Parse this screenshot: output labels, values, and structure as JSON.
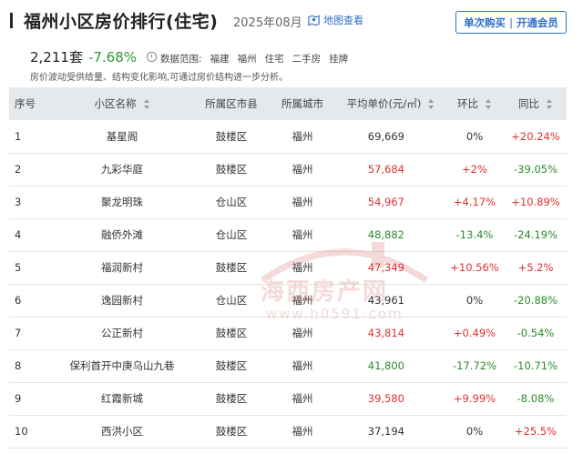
{
  "header": {
    "title": "福州小区房价排行(住宅)",
    "date": "2025年08月",
    "map_link": "地图查看",
    "buy_once": "单次购买",
    "divider": "|",
    "open_member": "开通会员"
  },
  "stats": {
    "count": "2,211套",
    "change": "-7.68%",
    "scope_label": "数据范围:",
    "tags": [
      "福建",
      "福州",
      "住宅",
      "二手房",
      "挂牌"
    ],
    "note": "房价波动受供给量、结构变化影响,可通过房价结构进一步分析。"
  },
  "table": {
    "columns": [
      "序号",
      "小区名称",
      "所属区市县",
      "所属城市",
      "平均单价(元/㎡)",
      "环比",
      "同比"
    ],
    "rows": [
      {
        "rank": "1",
        "name": "基星阁",
        "district": "鼓楼区",
        "city": "福州",
        "price": "69,669",
        "mom": "0%",
        "mom_dir": "zero",
        "yoy": "+20.24%",
        "yoy_dir": "pos",
        "price_dir": "zero"
      },
      {
        "rank": "2",
        "name": "九彩华庭",
        "district": "鼓楼区",
        "city": "福州",
        "price": "57,684",
        "mom": "+2%",
        "mom_dir": "pos",
        "yoy": "-39.05%",
        "yoy_dir": "neg",
        "price_dir": "pos"
      },
      {
        "rank": "3",
        "name": "聚龙明珠",
        "district": "仓山区",
        "city": "福州",
        "price": "54,967",
        "mom": "+4.17%",
        "mom_dir": "pos",
        "yoy": "+10.89%",
        "yoy_dir": "pos",
        "price_dir": "pos"
      },
      {
        "rank": "4",
        "name": "融侨外滩",
        "district": "仓山区",
        "city": "福州",
        "price": "48,882",
        "mom": "-13.4%",
        "mom_dir": "neg",
        "yoy": "-24.19%",
        "yoy_dir": "neg",
        "price_dir": "neg"
      },
      {
        "rank": "5",
        "name": "福润新村",
        "district": "鼓楼区",
        "city": "福州",
        "price": "47,349",
        "mom": "+10.56%",
        "mom_dir": "pos",
        "yoy": "+5.2%",
        "yoy_dir": "pos",
        "price_dir": "pos"
      },
      {
        "rank": "6",
        "name": "逸园新村",
        "district": "仓山区",
        "city": "福州",
        "price": "43,961",
        "mom": "0%",
        "mom_dir": "zero",
        "yoy": "-20.88%",
        "yoy_dir": "neg",
        "price_dir": "zero"
      },
      {
        "rank": "7",
        "name": "公正新村",
        "district": "鼓楼区",
        "city": "福州",
        "price": "43,814",
        "mom": "+0.49%",
        "mom_dir": "pos",
        "yoy": "-0.54%",
        "yoy_dir": "neg",
        "price_dir": "pos"
      },
      {
        "rank": "8",
        "name": "保利首开中庚乌山九巷",
        "district": "鼓楼区",
        "city": "福州",
        "price": "41,800",
        "mom": "-17.72%",
        "mom_dir": "neg",
        "yoy": "-10.71%",
        "yoy_dir": "neg",
        "price_dir": "neg"
      },
      {
        "rank": "9",
        "name": "红霞新城",
        "district": "鼓楼区",
        "city": "福州",
        "price": "39,580",
        "mom": "+9.99%",
        "mom_dir": "pos",
        "yoy": "-8.08%",
        "yoy_dir": "neg",
        "price_dir": "pos"
      },
      {
        "rank": "10",
        "name": "西洪小区",
        "district": "鼓楼区",
        "city": "福州",
        "price": "37,194",
        "mom": "0%",
        "mom_dir": "zero",
        "yoy": "+25.5%",
        "yoy_dir": "pos",
        "price_dir": "zero"
      }
    ]
  },
  "watermark": {
    "text": "海西房产网",
    "url": "www.h0591.com"
  },
  "colors": {
    "accent_blue": "#2f6fc7",
    "up_red": "#e03030",
    "down_green": "#2a8a2a",
    "header_bg": "#e5e8ec"
  }
}
